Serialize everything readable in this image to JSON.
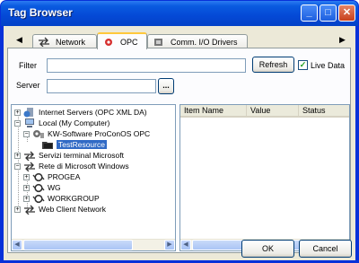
{
  "window": {
    "title": "Tag Browser"
  },
  "titlebar_buttons": {
    "minimize": "_",
    "maximize": "□",
    "close": "✕"
  },
  "tabs": [
    {
      "label": "Network"
    },
    {
      "label": "OPC"
    },
    {
      "label": "Comm. I/O Drivers"
    }
  ],
  "tab_scroll": {
    "left": "◀",
    "right": "▶"
  },
  "filter": {
    "label": "Filter",
    "value": ""
  },
  "refresh_button": "Refresh",
  "live_data": {
    "label": "Live Data",
    "checked": true,
    "mark": "✓"
  },
  "server": {
    "label": "Server",
    "value": "",
    "browse_label": "..."
  },
  "tree": [
    {
      "label": "Internet Servers (OPC XML DA)",
      "expander": "+",
      "icon": "globe-server-icon"
    },
    {
      "label": "Local (My Computer)",
      "expander": "−",
      "icon": "computer-icon"
    },
    {
      "label": "KW-Software ProConOS OPC",
      "expander": "−",
      "icon": "opc-server-icon"
    },
    {
      "label": "TestResource",
      "expander": "",
      "icon": "folder-icon",
      "selected": true
    },
    {
      "label": "Servizi terminal Microsoft",
      "expander": "+",
      "icon": "network-icon"
    },
    {
      "label": "Rete di Microsoft Windows",
      "expander": "−",
      "icon": "network-icon"
    },
    {
      "label": "PROGEA",
      "expander": "+",
      "icon": "workgroup-icon"
    },
    {
      "label": "WG",
      "expander": "+",
      "icon": "workgroup-icon"
    },
    {
      "label": "WORKGROUP",
      "expander": "+",
      "icon": "workgroup-icon"
    },
    {
      "label": "Web Client Network",
      "expander": "+",
      "icon": "network-icon"
    }
  ],
  "list_columns": [
    "Item Name",
    "Value",
    "Status"
  ],
  "ok_button": "OK",
  "cancel_button": "Cancel"
}
